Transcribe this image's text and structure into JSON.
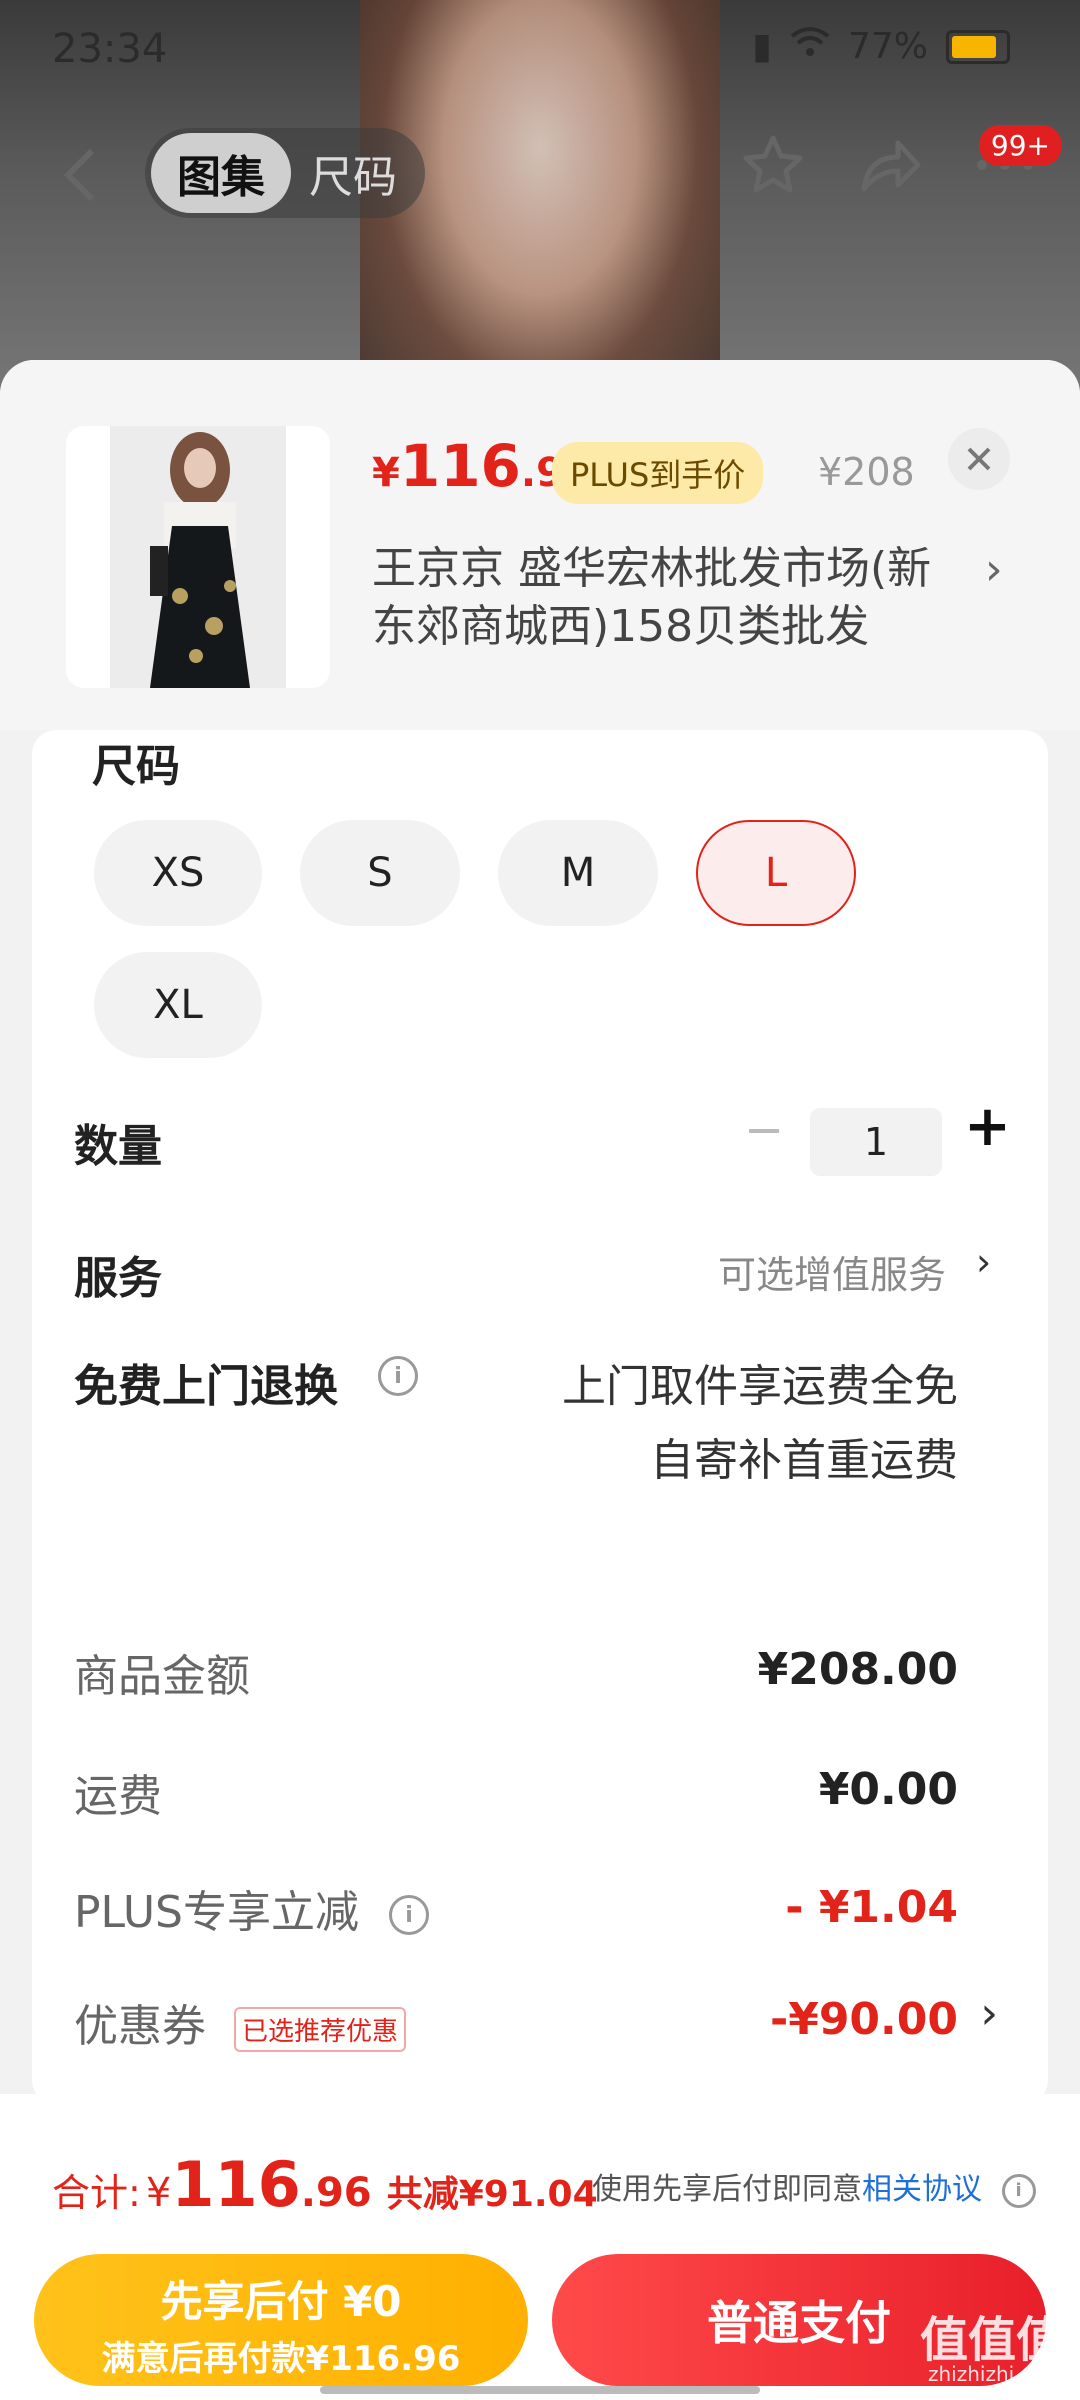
{
  "status": {
    "time": "23:34",
    "battery": "77%"
  },
  "nav": {
    "tab_active": "图集",
    "tab_inactive": "尺码",
    "badge": "99+"
  },
  "product": {
    "price_currency": "¥",
    "price_int": "116",
    "price_dec": ".96",
    "plus_tag": "PLUS到手价",
    "original_price": "¥208",
    "shop_name": "王京京  盛华宏林批发市场(新东郊商城西)158贝类批发"
  },
  "size": {
    "label": "尺码",
    "options": [
      "XS",
      "S",
      "M",
      "L",
      "XL"
    ],
    "selected": "L"
  },
  "quantity": {
    "label": "数量",
    "minus": "−",
    "value": "1",
    "plus": "+"
  },
  "service": {
    "label": "服务",
    "hint": "可选增值服务"
  },
  "return": {
    "label": "免费上门退换",
    "line1": "上门取件享运费全免",
    "line2": "自寄补首重运费"
  },
  "summary": {
    "goods_label": "商品金额",
    "goods_value": "¥208.00",
    "shipping_label": "运费",
    "shipping_value": "¥0.00",
    "plus_label": "PLUS专享立减",
    "plus_value": "- ¥1.04",
    "coupon_label": "优惠券",
    "coupon_tag": "已选推荐优惠",
    "coupon_value": "-¥90.00"
  },
  "footer": {
    "total_label": "合计:",
    "total_currency": "¥",
    "total_int": "116",
    "total_dec": ".96",
    "total_reduce": "共减¥91.04",
    "agree_text": "使用先享后付即同意",
    "agree_link": "相关协议",
    "pay_later_line1": "先享后付 ¥0",
    "pay_later_line2": "满意后再付款¥116.96",
    "pay_normal": "普通支付"
  },
  "watermark": {
    "main": "值值值",
    "sub": "zhizhizhi.com"
  },
  "colors": {
    "accent_red": "#e2231a",
    "plus_gold": "#fde9a8",
    "pay_later_yellow": "#ffb000"
  }
}
